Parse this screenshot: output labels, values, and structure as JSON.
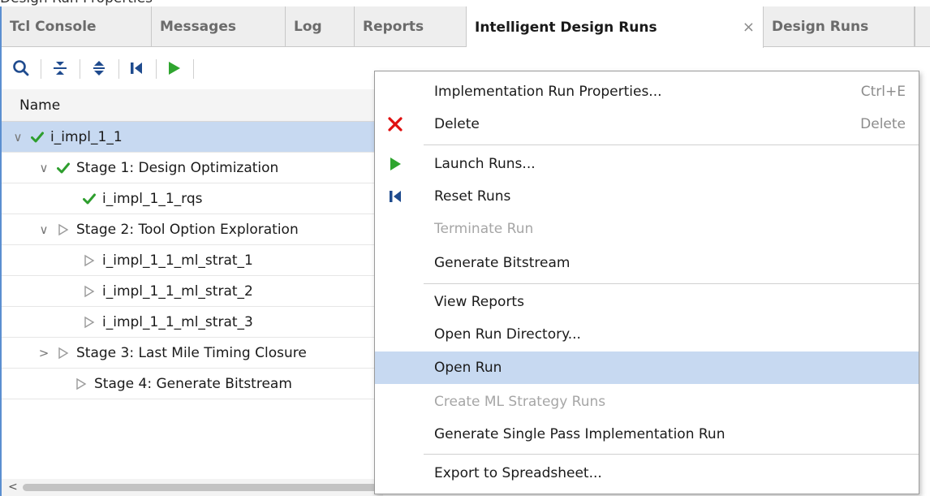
{
  "window": {
    "top_strip_text": "Design Run Properties"
  },
  "tabs": [
    {
      "label": "Tcl Console"
    },
    {
      "label": "Messages"
    },
    {
      "label": "Log"
    },
    {
      "label": "Reports"
    },
    {
      "label": "Intelligent Design Runs",
      "close": "×"
    },
    {
      "label": "Design Runs"
    }
  ],
  "toolbar": {
    "icons": [
      "search-icon",
      "collapse-all-icon",
      "expand-all-icon",
      "reset-runs-icon",
      "launch-runs-icon"
    ]
  },
  "tree": {
    "column_header": "Name",
    "rows": [
      {
        "label": "i_impl_1_1",
        "expander": "∨",
        "status": "complete",
        "selected": true
      },
      {
        "label": "Stage 1: Design Optimization",
        "expander": "∨",
        "status": "complete"
      },
      {
        "label": "i_impl_1_1_rqs",
        "expander": "",
        "status": "complete"
      },
      {
        "label": "Stage 2: Tool Option Exploration",
        "expander": "∨",
        "status": "not-started"
      },
      {
        "label": "i_impl_1_1_ml_strat_1",
        "expander": "",
        "status": "not-started"
      },
      {
        "label": "i_impl_1_1_ml_strat_2",
        "expander": "",
        "status": "not-started"
      },
      {
        "label": "i_impl_1_1_ml_strat_3",
        "expander": "",
        "status": "not-started"
      },
      {
        "label": "Stage 3: Last Mile Timing Closure",
        "expander": ">",
        "status": "not-started"
      },
      {
        "label": "Stage 4: Generate Bitstream",
        "expander": "",
        "status": "not-started"
      }
    ]
  },
  "context_menu": {
    "items": [
      {
        "label": "Implementation Run Properties...",
        "shortcut": "Ctrl+E"
      },
      {
        "label": "Delete",
        "shortcut": "Delete",
        "icon": "delete-x-icon"
      },
      {
        "label": "Launch Runs...",
        "icon": "launch-runs-icon"
      },
      {
        "label": "Reset Runs",
        "icon": "reset-runs-icon"
      },
      {
        "label": "Terminate Run",
        "disabled": true
      },
      {
        "label": "Generate Bitstream"
      },
      {
        "label": "View Reports"
      },
      {
        "label": "Open Run Directory..."
      },
      {
        "label": "Open Run",
        "highlighted": true
      },
      {
        "label": "Create ML Strategy Runs",
        "disabled": true
      },
      {
        "label": "Generate Single Pass Implementation Run"
      },
      {
        "label": "Export to Spreadsheet..."
      }
    ]
  },
  "colors": {
    "selection": "#c7d9f1",
    "check_green": "#2e9e2e",
    "play_green": "#2fa52f",
    "delete_red": "#e01010",
    "icon_blue": "#1f4b8e"
  }
}
